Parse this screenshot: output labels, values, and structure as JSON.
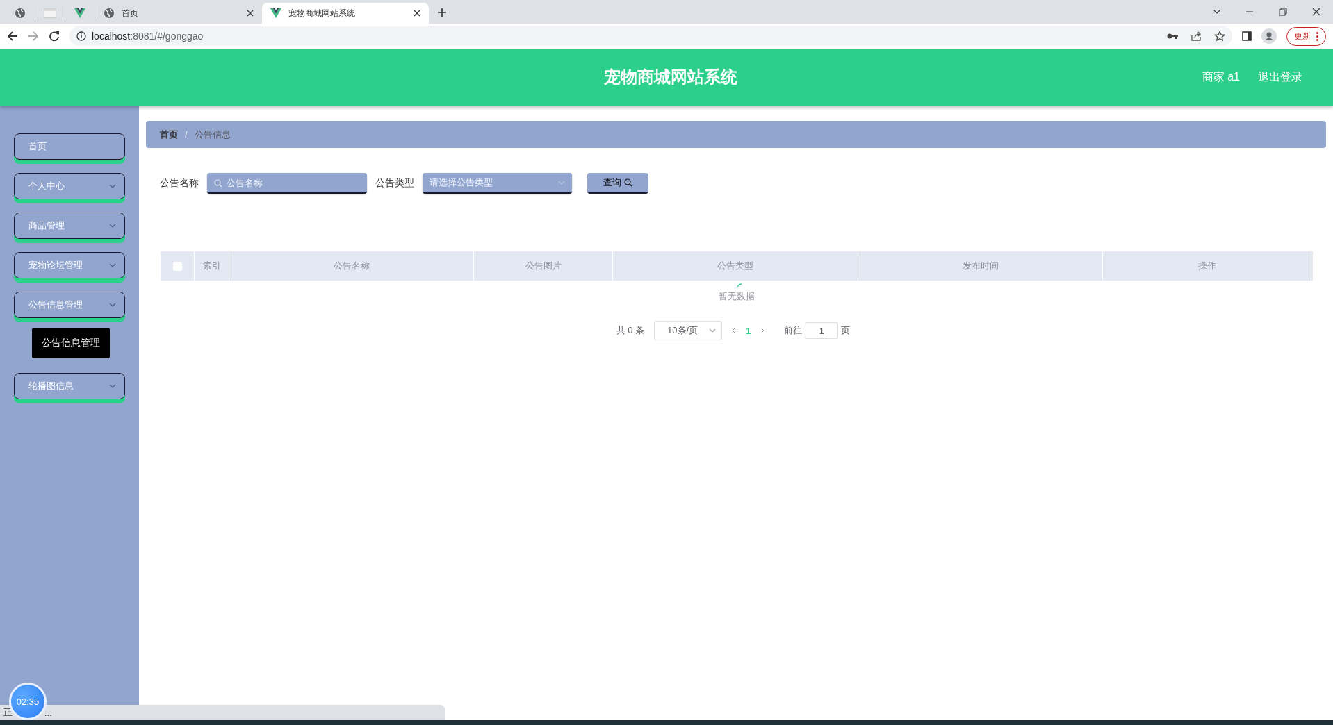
{
  "browser": {
    "tabs": [
      {
        "kind": "globe",
        "selected": false
      },
      {
        "kind": "blank",
        "selected": false
      },
      {
        "kind": "vue",
        "selected": false
      },
      {
        "kind": "globe",
        "title": "首页",
        "selected": false
      },
      {
        "kind": "vue",
        "title": "宠物商城网站系统",
        "selected": true
      }
    ],
    "url_host": "localhost",
    "url_rest": ":8081/#/gonggao",
    "update_button": "更新"
  },
  "header": {
    "title": "宠物商城网站系统",
    "user": "商家 a1",
    "logout": "退出登录"
  },
  "sidebar": {
    "items": [
      {
        "label": "首页",
        "expandable": false
      },
      {
        "label": "个人中心",
        "expandable": true
      },
      {
        "label": "商品管理",
        "expandable": true
      },
      {
        "label": "宠物论坛管理",
        "expandable": true
      },
      {
        "label": "公告信息管理",
        "expandable": true,
        "tooltip": "公告信息管理"
      },
      {
        "label": "轮播图信息",
        "expandable": true
      }
    ]
  },
  "breadcrumb": {
    "separator": "/",
    "items": [
      {
        "label": "首页",
        "current": false
      },
      {
        "label": "公告信息",
        "current": true
      }
    ]
  },
  "search": {
    "fields": [
      {
        "label": "公告名称",
        "kind": "input",
        "placeholder": "公告名称"
      },
      {
        "label": "公告类型",
        "kind": "select",
        "placeholder": "请选择公告类型"
      }
    ],
    "button": "查询"
  },
  "table": {
    "checked": false,
    "columns": [
      "索引",
      "公告名称",
      "公告图片",
      "公告类型",
      "发布时间",
      "操作"
    ],
    "empty_text": "暂无数据"
  },
  "pagination": {
    "total": "共 0 条",
    "page_size": "10条/页",
    "pages": [
      {
        "label": "1",
        "selected": true
      }
    ],
    "goto_label": "前往",
    "goto_value": "1",
    "page_suffix": "页"
  },
  "timer": "02:35",
  "status_bar": {
    "text_start": "正",
    "text_end": "..."
  }
}
